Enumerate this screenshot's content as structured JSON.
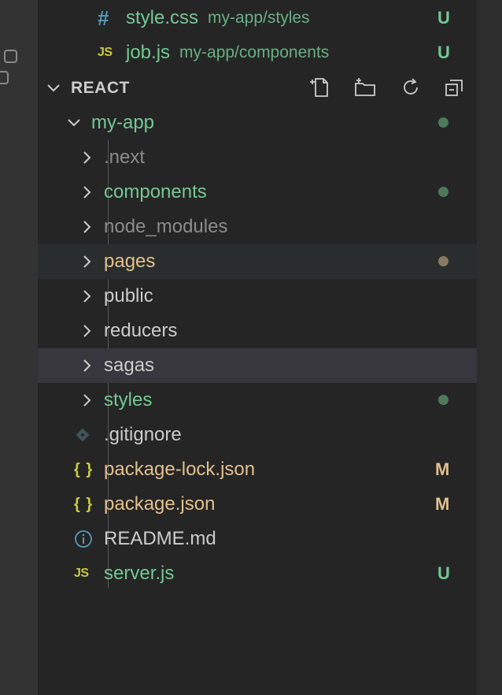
{
  "open_editors": [
    {
      "icon": "css-hash-icon",
      "icon_glyph": "#",
      "name": "style.css",
      "path": "my-app/styles",
      "status": "U"
    },
    {
      "icon": "js-file-icon",
      "icon_glyph": "JS",
      "name": "job.js",
      "path": "my-app/components",
      "status": "U"
    }
  ],
  "section": {
    "title": "REACT"
  },
  "toolbar_icons": [
    "new-file-icon",
    "new-folder-icon",
    "refresh-icon",
    "collapse-all-icon"
  ],
  "root": {
    "name": "my-app"
  },
  "tree": [
    {
      "name": ".next",
      "type": "folder"
    },
    {
      "name": "components",
      "type": "folder"
    },
    {
      "name": "node_modules",
      "type": "folder"
    },
    {
      "name": "pages",
      "type": "folder"
    },
    {
      "name": "public",
      "type": "folder"
    },
    {
      "name": "reducers",
      "type": "folder"
    },
    {
      "name": "sagas",
      "type": "folder"
    },
    {
      "name": "styles",
      "type": "folder"
    },
    {
      "name": ".gitignore",
      "type": "file",
      "icon": "git-diamond-icon"
    },
    {
      "name": "package-lock.json",
      "type": "file",
      "icon": "json-braces-icon",
      "icon_glyph": "{ }",
      "status": "M"
    },
    {
      "name": "package.json",
      "type": "file",
      "icon": "json-braces-icon",
      "icon_glyph": "{ }",
      "status": "M"
    },
    {
      "name": "README.md",
      "type": "file",
      "icon": "info-icon",
      "icon_glyph": "i"
    },
    {
      "name": "server.js",
      "type": "file",
      "icon": "js-file-icon",
      "icon_glyph": "JS",
      "status": "U"
    }
  ],
  "colors": {
    "untracked_green": "#73c991",
    "modified_yellow": "#e2c08d",
    "ignored_gray": "#8c8c8c",
    "dot_green": "#4d7a5a",
    "dot_tan": "#8a7a63",
    "selected_row": "#37373d",
    "hover_row": "#2a2d2e"
  }
}
